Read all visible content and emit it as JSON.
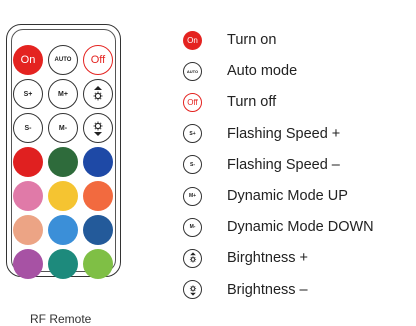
{
  "remote": {
    "buttons": {
      "on": "On",
      "auto": "AUTO",
      "off": "Off",
      "s_plus": "S+",
      "m_plus": "M+",
      "s_minus": "S-",
      "m_minus": "M-"
    },
    "color_buttons": [
      "#e02020",
      "#2e6b3b",
      "#1e49a6",
      "#e07aa8",
      "#f5c431",
      "#f26a3f",
      "#eca485",
      "#3b8fd8",
      "#235a9a",
      "#a752a4",
      "#1d8a7c",
      "#7fbf45"
    ],
    "caption": "RF Remote"
  },
  "legend": {
    "items": [
      {
        "label": "Turn on",
        "icon": "on-icon",
        "icon_text": "On"
      },
      {
        "label": "Auto mode",
        "icon": "auto-icon",
        "icon_text": "AUTO"
      },
      {
        "label": "Turn off",
        "icon": "off-icon",
        "icon_text": "Off"
      },
      {
        "label": "Flashing Speed +",
        "icon": "speed-plus-icon",
        "icon_text": "S+"
      },
      {
        "label": "Flashing Speed –",
        "icon": "speed-minus-icon",
        "icon_text": "S-"
      },
      {
        "label": "Dynamic Mode UP",
        "icon": "mode-plus-icon",
        "icon_text": "M+"
      },
      {
        "label": "Dynamic Mode DOWN",
        "icon": "mode-minus-icon",
        "icon_text": "M-"
      },
      {
        "label": "Birghtness +",
        "icon": "brightness-up-icon"
      },
      {
        "label": "Brightness –",
        "icon": "brightness-down-icon"
      }
    ]
  }
}
